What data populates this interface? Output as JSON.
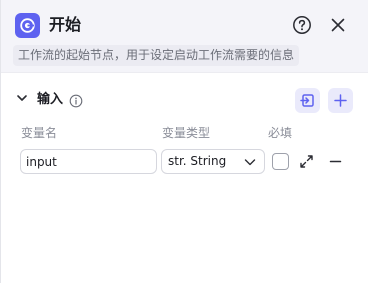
{
  "node": {
    "title": "开始",
    "description": "工作流的起始节点，用于设定启动工作流需要的信息",
    "icon": "workflow-start-icon",
    "accent_color": "#5e62f0"
  },
  "inputs": {
    "title": "输入",
    "columns": {
      "name": "变量名",
      "type": "变量类型",
      "required": "必填"
    },
    "rows": [
      {
        "name": "input",
        "type": "str. String",
        "required": false
      }
    ]
  }
}
